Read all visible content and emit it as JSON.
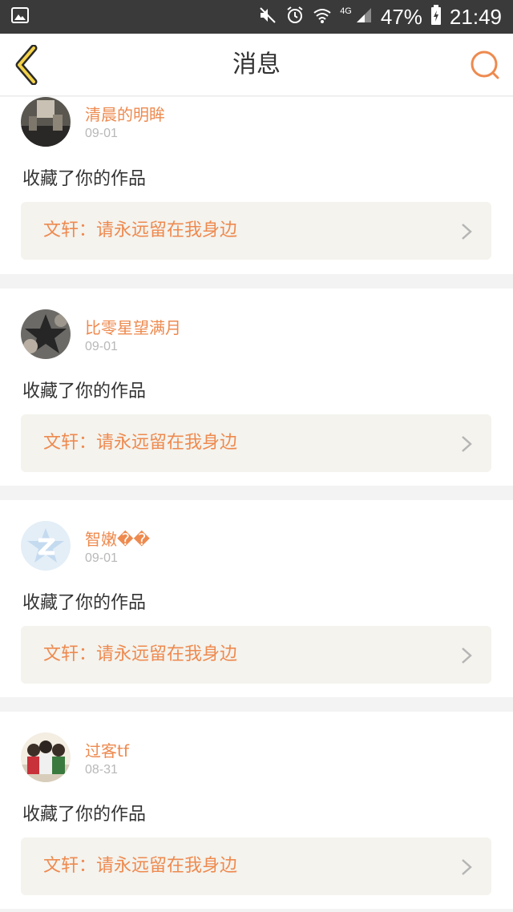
{
  "status_bar": {
    "network": "4G",
    "battery": "47%",
    "time": "21:49",
    "icons": [
      "image-icon",
      "mute-icon",
      "alarm-icon",
      "wifi-icon",
      "signal-icon",
      "battery-charging-icon"
    ]
  },
  "header": {
    "title": "消息",
    "back_icon": "chevron-left-icon",
    "search_icon": "search-icon",
    "accent_color": "#ee8a4f"
  },
  "messages": [
    {
      "username": "清晨的明眸",
      "date": "09-01",
      "action": "收藏了你的作品",
      "work": "文轩：请永远留在我身边"
    },
    {
      "username": "比零星望满月",
      "date": "09-01",
      "action": "收藏了你的作品",
      "work": "文轩：请永远留在我身边"
    },
    {
      "username": "智嫩��",
      "date": "09-01",
      "action": "收藏了你的作品",
      "work": "文轩：请永远留在我身边"
    },
    {
      "username": "过客tf",
      "date": "08-31",
      "action": "收藏了你的作品",
      "work": "文轩：请永远留在我身边"
    }
  ]
}
